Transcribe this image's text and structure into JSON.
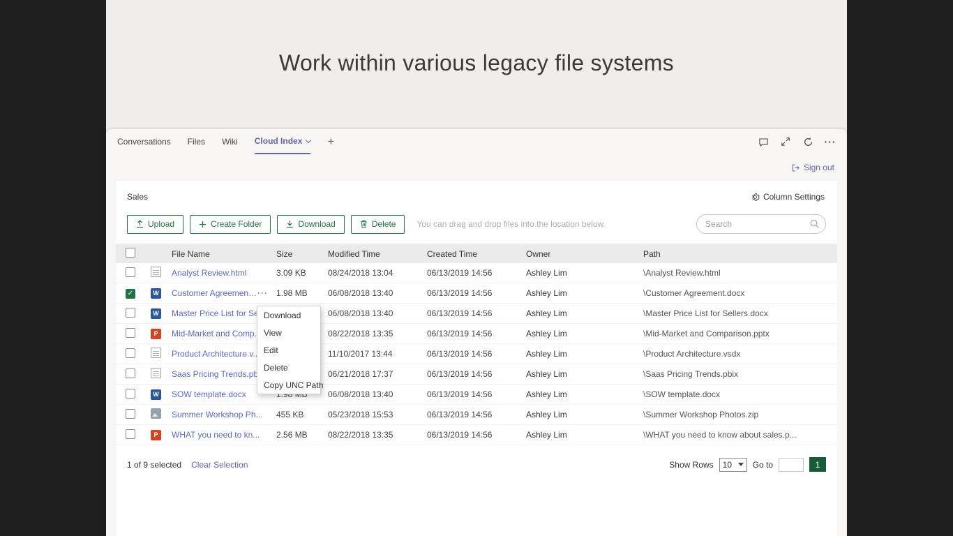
{
  "colors": {
    "accent_green": "#217346",
    "accent_purple": "#6264a7",
    "link_blue": "#5b6abf",
    "page_green": "#185c37"
  },
  "page": {
    "title": "Work within various legacy file systems"
  },
  "tabs": {
    "items": [
      "Conversations",
      "Files",
      "Wiki",
      "Cloud Index"
    ],
    "active": "Cloud Index"
  },
  "header": {
    "signout_label": "Sign out"
  },
  "panel": {
    "breadcrumb": "Sales",
    "column_settings_label": "Column Settings"
  },
  "toolbar": {
    "upload_label": "Upload",
    "create_folder_label": "Create Folder",
    "download_label": "Download",
    "delete_label": "Delete",
    "hint": "You can drag and drop files into the location below.",
    "search_placeholder": "Search"
  },
  "table": {
    "columns": [
      "File Name",
      "Size",
      "Modified Time",
      "Created Time",
      "Owner",
      "Path"
    ],
    "rows": [
      {
        "name": "Analyst Review.html",
        "icon": "generic-file-icon",
        "size": "3.09 KB",
        "modified": "08/24/2018 13:04",
        "created": "06/13/2019 14:56",
        "owner": "Ashley Lim",
        "path": "\\Analyst Review.html",
        "checked": false
      },
      {
        "name": "Customer Agreement...",
        "icon": "word-file-icon",
        "size": "1.98 MB",
        "modified": "06/08/2018 13:40",
        "created": "06/13/2019 14:56",
        "owner": "Ashley Lim",
        "path": "\\Customer Agreement.docx",
        "checked": true
      },
      {
        "name": "Master Price List for Se...",
        "icon": "word-file-icon",
        "size": "",
        "modified": "06/08/2018 13:40",
        "created": "06/13/2019 14:56",
        "owner": "Ashley Lim",
        "path": "\\Master Price List for Sellers.docx",
        "checked": false
      },
      {
        "name": "Mid-Market and Comp...",
        "icon": "powerpoint-file-icon",
        "size": "",
        "modified": "08/22/2018 13:35",
        "created": "06/13/2019 14:56",
        "owner": "Ashley Lim",
        "path": "\\Mid-Market and Comparison.pptx",
        "checked": false
      },
      {
        "name": "Product Architecture.v...",
        "icon": "generic-file-icon",
        "size": "",
        "modified": "11/10/2017 13:44",
        "created": "06/13/2019 14:56",
        "owner": "Ashley Lim",
        "path": "\\Product Architecture.vsdx",
        "checked": false
      },
      {
        "name": "Saas Pricing Trends.pbix",
        "icon": "generic-file-icon",
        "size": "",
        "modified": "06/21/2018 17:37",
        "created": "06/13/2019 14:56",
        "owner": "Ashley Lim",
        "path": "\\Saas Pricing Trends.pbix",
        "checked": false
      },
      {
        "name": "SOW template.docx",
        "icon": "word-file-icon",
        "size": "1.98 MB",
        "modified": "06/08/2018 13:40",
        "created": "06/13/2019 14:56",
        "owner": "Ashley Lim",
        "path": "\\SOW template.docx",
        "checked": false
      },
      {
        "name": "Summer Workshop Ph...",
        "icon": "image-file-icon",
        "size": "455 KB",
        "modified": "05/23/2018 15:53",
        "created": "06/13/2019 14:56",
        "owner": "Ashley Lim",
        "path": "\\Summer Workshop Photos.zip",
        "checked": false
      },
      {
        "name": "WHAT you need to kn...",
        "icon": "powerpoint-file-icon",
        "size": "2.56 MB",
        "modified": "08/22/2018 13:35",
        "created": "06/13/2019 14:56",
        "owner": "Ashley Lim",
        "path": "\\WHAT you need to know about sales.p...",
        "checked": false
      }
    ]
  },
  "context_menu": {
    "items": [
      "Download",
      "View",
      "Edit",
      "Delete",
      "Copy UNC Path"
    ]
  },
  "footer": {
    "selected_text": "1 of 9 selected",
    "clear_label": "Clear Selection",
    "show_rows_label": "Show Rows",
    "rows_per_page": "10",
    "goto_label": "Go to",
    "page": "1"
  }
}
